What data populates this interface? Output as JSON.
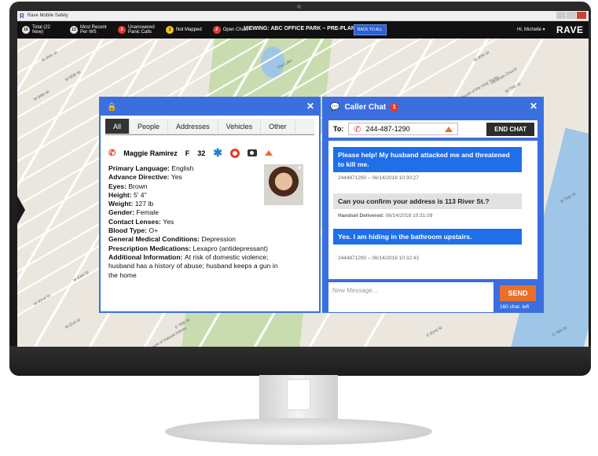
{
  "app": {
    "window_title": "Rave Mobile Safety",
    "brand": "RAVE",
    "user_menu": "Hi, Michelle ▾"
  },
  "topbar": {
    "stats": [
      {
        "count": "16",
        "label": "Total (22 New)",
        "color": "#e6e6e6",
        "text_color": "#111"
      },
      {
        "count": "13",
        "label": "Most Recent Per WS",
        "color": "#e6e6e6",
        "text_color": "#111"
      },
      {
        "count": "2",
        "label": "Unanswered Panic Calls",
        "color": "#e23b2e",
        "text_color": "#fff"
      },
      {
        "count": "1",
        "label": "Not Mapped",
        "color": "#f3c316",
        "text_color": "#111"
      },
      {
        "count": "2",
        "label": "Open Chats",
        "color": "#e23b2e",
        "text_color": "#fff"
      }
    ],
    "viewing": "VIEWING: ABC OFFICE PARK – PRE-PLAN",
    "back_to_all": "BACK TO ALL"
  },
  "profile_panel": {
    "tabs": [
      "All",
      "People",
      "Addresses",
      "Vehicles",
      "Other"
    ],
    "active_tab": "All",
    "name": "Maggie Ramirez",
    "sex": "F",
    "age": "32",
    "fields": [
      {
        "label": "Primary Language:",
        "value": "English"
      },
      {
        "label": "Advance Directive:",
        "value": "Yes"
      },
      {
        "label": "Eyes:",
        "value": "Brown"
      },
      {
        "label": "Height:",
        "value": "5' 4\""
      },
      {
        "label": "Weight:",
        "value": "127 lb"
      },
      {
        "label": "Gender:",
        "value": "Female"
      },
      {
        "label": "Contact Lenses:",
        "value": "Yes"
      },
      {
        "label": "Blood Type:",
        "value": "O+"
      },
      {
        "label": "General Medical Conditions:",
        "value": "Depression"
      },
      {
        "label": "Prescription Medications:",
        "value": "Lexapro (antidepressant)"
      },
      {
        "label": "Additional Information:",
        "value": "At risk of domestic violence; husband has a history of abuse; husband keeps a gun in the home"
      }
    ]
  },
  "chat_panel": {
    "title": "Caller Chat",
    "badge": "1",
    "to_label": "To:",
    "to_number": "244-487-1290",
    "end_chat": "END CHAT",
    "messages": [
      {
        "dir": "in",
        "text": "Please help! My husband attacked me and threatened to kill me.",
        "meta": "2444871290 – 06/14/2018 10:30:27"
      },
      {
        "dir": "out",
        "text": "Can you confirm your address is 113 River St.?",
        "meta_label": "Handset Delivered:",
        "meta": "06/14/2018 10:31:09"
      },
      {
        "dir": "in",
        "text": "Yes.  I am hiding in the bathroom upstairs.",
        "meta": "2444871290 – 06/14/2018 10:32:43"
      }
    ],
    "compose_placeholder": "New Message...",
    "send": "SEND",
    "chars_left": "160 char. left"
  },
  "map": {
    "labels": [
      "W 86th St",
      "W 85th St",
      "W 84th St",
      "W 83rd St",
      "W 82nd St",
      "W 81st St",
      "W 80th St",
      "W 79th St",
      "W 78th St",
      "W 77th St",
      "W 76th St",
      "E 86th St",
      "E 84th St",
      "E 82nd St",
      "E 80th St",
      "E 78th St",
      "E 76th St",
      "The Lake",
      "Museum of Natural History",
      "Church of the Holy Trinity",
      "Ukrainian Church"
    ]
  },
  "colors": {
    "panel_blue": "#3b6fe0",
    "bubble_blue": "#1e6fe8",
    "orange": "#e8702a",
    "red": "#e23b2e"
  }
}
